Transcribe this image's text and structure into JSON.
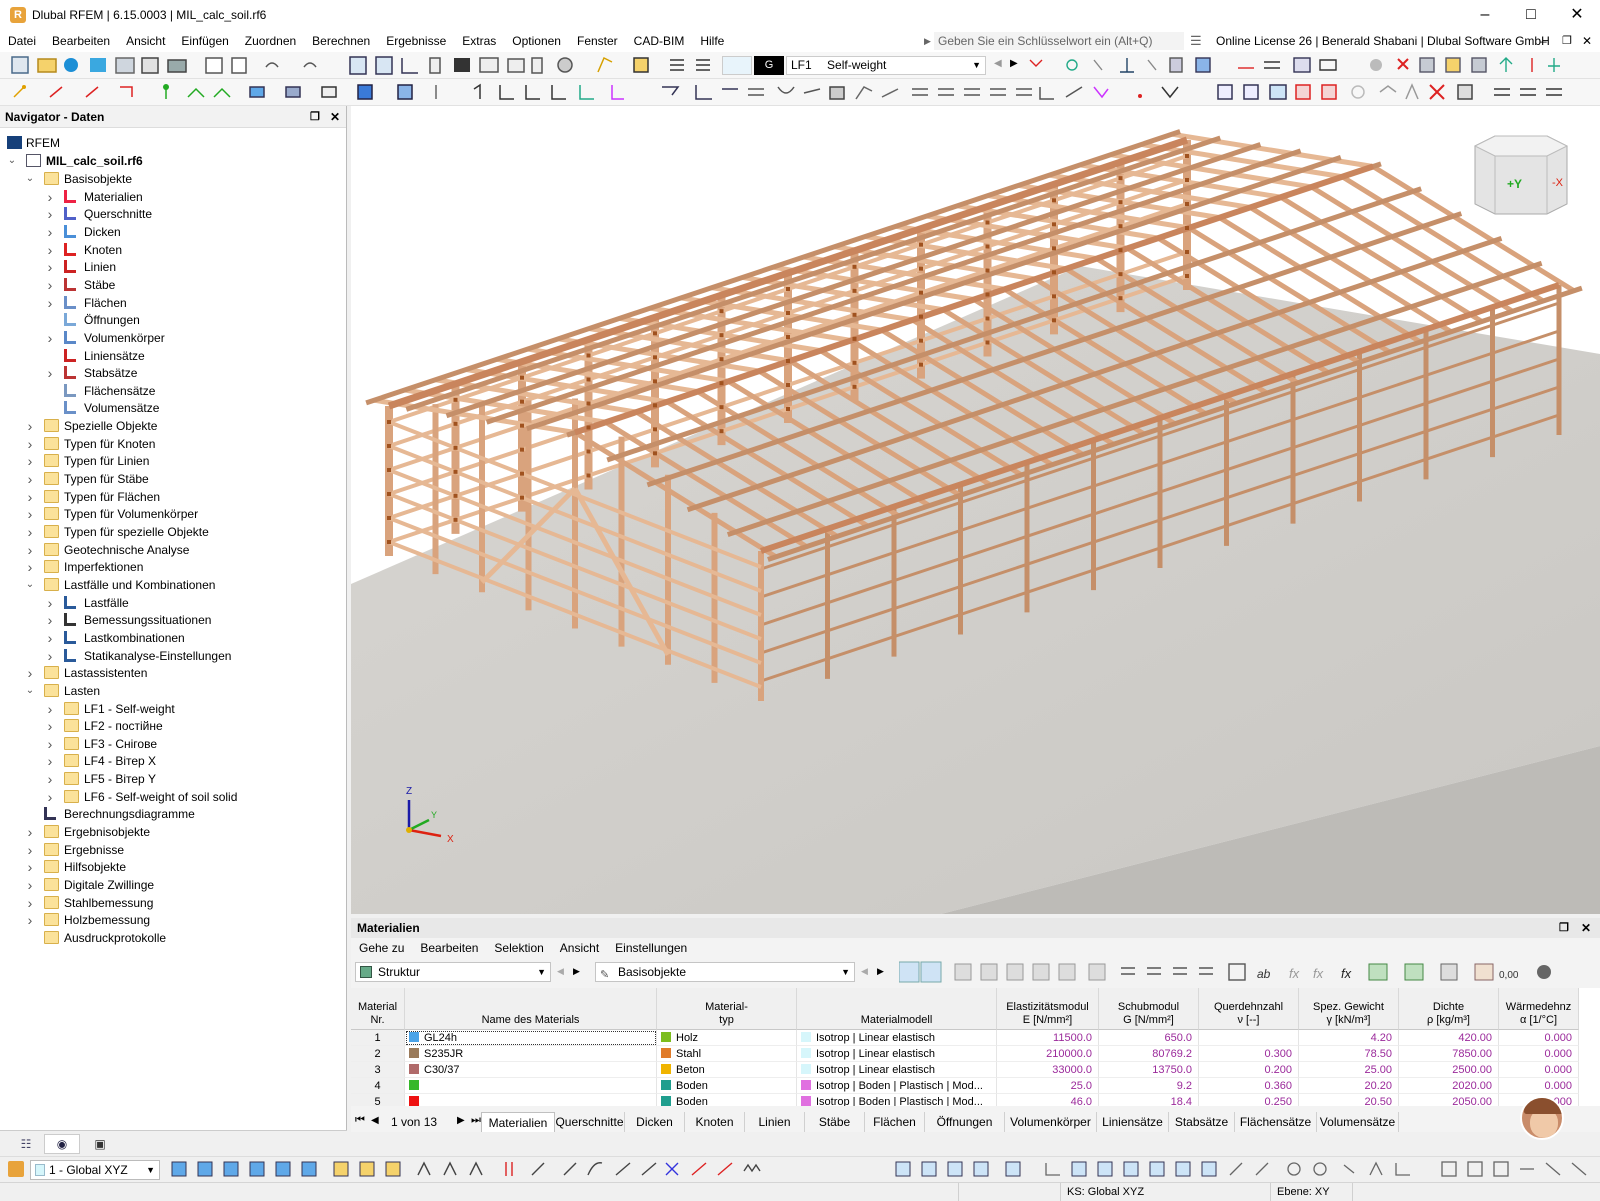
{
  "window": {
    "title": "Dlubal RFEM | 6.15.0003 | MIL_calc_soil.rf6"
  },
  "menu": {
    "items": [
      "Datei",
      "Bearbeiten",
      "Ansicht",
      "Einfügen",
      "Zuordnen",
      "Berechnen",
      "Ergebnisse",
      "Extras",
      "Optionen",
      "Fenster",
      "CAD-BIM",
      "Hilfe"
    ],
    "search_placeholder": "Geben Sie ein Schlüsselwort ein (Alt+Q)",
    "license": "Online License 26 | Benerald Shabani | Dlubal Software GmbH"
  },
  "toolbar": {
    "lc_badge": "G",
    "lc_id": "LF1",
    "lc_name": "Self-weight"
  },
  "navigator": {
    "title": "Navigator - Daten",
    "root": "RFEM",
    "file": "MIL_calc_soil.rf6",
    "items": [
      {
        "label": "Basisobjekte",
        "level": 1,
        "expand": "open",
        "icon": "folder"
      },
      {
        "label": "Materialien",
        "level": 2,
        "expand": "closed",
        "icon": "materials"
      },
      {
        "label": "Querschnitte",
        "level": 2,
        "expand": "closed",
        "icon": "sections"
      },
      {
        "label": "Dicken",
        "level": 2,
        "expand": "closed",
        "icon": "thickness"
      },
      {
        "label": "Knoten",
        "level": 2,
        "expand": "closed",
        "icon": "node"
      },
      {
        "label": "Linien",
        "level": 2,
        "expand": "closed",
        "icon": "line"
      },
      {
        "label": "Stäbe",
        "level": 2,
        "expand": "closed",
        "icon": "member"
      },
      {
        "label": "Flächen",
        "level": 2,
        "expand": "closed",
        "icon": "surface"
      },
      {
        "label": "Öffnungen",
        "level": 2,
        "expand": "none",
        "icon": "opening"
      },
      {
        "label": "Volumenkörper",
        "level": 2,
        "expand": "closed",
        "icon": "solid"
      },
      {
        "label": "Liniensätze",
        "level": 2,
        "expand": "none",
        "icon": "lineset"
      },
      {
        "label": "Stabsätze",
        "level": 2,
        "expand": "closed",
        "icon": "memberset"
      },
      {
        "label": "Flächensätze",
        "level": 2,
        "expand": "none",
        "icon": "surfaceset"
      },
      {
        "label": "Volumensätze",
        "level": 2,
        "expand": "none",
        "icon": "solidset"
      },
      {
        "label": "Spezielle Objekte",
        "level": 1,
        "expand": "closed",
        "icon": "folder"
      },
      {
        "label": "Typen für Knoten",
        "level": 1,
        "expand": "closed",
        "icon": "folder"
      },
      {
        "label": "Typen für Linien",
        "level": 1,
        "expand": "closed",
        "icon": "folder"
      },
      {
        "label": "Typen für Stäbe",
        "level": 1,
        "expand": "closed",
        "icon": "folder"
      },
      {
        "label": "Typen für Flächen",
        "level": 1,
        "expand": "closed",
        "icon": "folder"
      },
      {
        "label": "Typen für Volumenkörper",
        "level": 1,
        "expand": "closed",
        "icon": "folder"
      },
      {
        "label": "Typen für spezielle Objekte",
        "level": 1,
        "expand": "closed",
        "icon": "folder"
      },
      {
        "label": "Geotechnische Analyse",
        "level": 1,
        "expand": "closed",
        "icon": "folder"
      },
      {
        "label": "Imperfektionen",
        "level": 1,
        "expand": "closed",
        "icon": "folder"
      },
      {
        "label": "Lastfälle und Kombinationen",
        "level": 1,
        "expand": "open",
        "icon": "folder"
      },
      {
        "label": "Lastfälle",
        "level": 2,
        "expand": "closed",
        "icon": "loadcase"
      },
      {
        "label": "Bemessungssituationen",
        "level": 2,
        "expand": "closed",
        "icon": "designsit"
      },
      {
        "label": "Lastkombinationen",
        "level": 2,
        "expand": "closed",
        "icon": "loadcombo"
      },
      {
        "label": "Statikanalyse-Einstellungen",
        "level": 2,
        "expand": "closed",
        "icon": "analysis"
      },
      {
        "label": "Lastassistenten",
        "level": 1,
        "expand": "closed",
        "icon": "folder"
      },
      {
        "label": "Lasten",
        "level": 1,
        "expand": "open",
        "icon": "folder"
      },
      {
        "label": "LF1 - Self-weight",
        "level": 2,
        "expand": "closed",
        "icon": "folder"
      },
      {
        "label": "LF2 - постійне",
        "level": 2,
        "expand": "closed",
        "icon": "folder"
      },
      {
        "label": "LF3 - Снігове",
        "level": 2,
        "expand": "closed",
        "icon": "folder"
      },
      {
        "label": "LF4 - Вітер X",
        "level": 2,
        "expand": "closed",
        "icon": "folder"
      },
      {
        "label": "LF5 - Вітер Y",
        "level": 2,
        "expand": "closed",
        "icon": "folder"
      },
      {
        "label": "LF6 - Self-weight of soil solid",
        "level": 2,
        "expand": "closed",
        "icon": "folder"
      },
      {
        "label": "Berechnungsdiagramme",
        "level": 1,
        "expand": "none",
        "icon": "diagram"
      },
      {
        "label": "Ergebnisobjekte",
        "level": 1,
        "expand": "closed",
        "icon": "folder"
      },
      {
        "label": "Ergebnisse",
        "level": 1,
        "expand": "closed",
        "icon": "folder"
      },
      {
        "label": "Hilfsobjekte",
        "level": 1,
        "expand": "closed",
        "icon": "folder"
      },
      {
        "label": "Digitale Zwillinge",
        "level": 1,
        "expand": "closed",
        "icon": "folder"
      },
      {
        "label": "Stahlbemessung",
        "level": 1,
        "expand": "closed",
        "icon": "folder"
      },
      {
        "label": "Holzbemessung",
        "level": 1,
        "expand": "closed",
        "icon": "folder"
      },
      {
        "label": "Ausdruckprotokolle",
        "level": 1,
        "expand": "none",
        "icon": "folder"
      }
    ]
  },
  "viewport": {
    "axis_x": "X",
    "axis_y": "Y",
    "axis_z": "Z",
    "cube_y": "+Y",
    "cube_x": "-X"
  },
  "panel": {
    "title": "Materialien",
    "menu": [
      "Gehe zu",
      "Bearbeiten",
      "Selektion",
      "Ansicht",
      "Einstellungen"
    ],
    "combo_left": "Struktur",
    "combo_right": "Basisobjekte",
    "columns": [
      {
        "l1": "Material",
        "l2": "Nr."
      },
      {
        "l1": "",
        "l2": "Name des Materials"
      },
      {
        "l1": "Material-",
        "l2": "typ"
      },
      {
        "l1": "",
        "l2": "Materialmodell"
      },
      {
        "l1": "Elastizitätsmodul",
        "l2": "E [N/mm²]"
      },
      {
        "l1": "Schubmodul",
        "l2": "G [N/mm²]"
      },
      {
        "l1": "Querdehnzahl",
        "l2": "ν [--]"
      },
      {
        "l1": "Spez. Gewicht",
        "l2": "γ [kN/m³]"
      },
      {
        "l1": "Dichte",
        "l2": "ρ [kg/m³]"
      },
      {
        "l1": "Wärmedehnz",
        "l2": "α [1/°C]"
      }
    ],
    "rows": [
      {
        "nr": "1",
        "name": "GL24h",
        "name_color": "#4aa3e8",
        "type": "Holz",
        "type_color": "#7cbd1e",
        "model": "Isotrop | Linear elastisch",
        "model_color": "#d6f6fb",
        "e": "11500.0",
        "g": "650.0",
        "nu": "",
        "gamma": "4.20",
        "rho": "420.00",
        "alpha": "0.000"
      },
      {
        "nr": "2",
        "name": "S235JR",
        "name_color": "#9a7a5a",
        "type": "Stahl",
        "type_color": "#e07b2a",
        "model": "Isotrop | Linear elastisch",
        "model_color": "#d6f6fb",
        "e": "210000.0",
        "g": "80769.2",
        "nu": "0.300",
        "gamma": "78.50",
        "rho": "7850.00",
        "alpha": "0.000"
      },
      {
        "nr": "3",
        "name": "C30/37",
        "name_color": "#b06a6a",
        "type": "Beton",
        "type_color": "#f0b400",
        "model": "Isotrop | Linear elastisch",
        "model_color": "#d6f6fb",
        "e": "33000.0",
        "g": "13750.0",
        "nu": "0.200",
        "gamma": "25.00",
        "rho": "2500.00",
        "alpha": "0.000"
      },
      {
        "nr": "4",
        "name": "",
        "name_color": "#35b829",
        "type": "Boden",
        "type_color": "#1f9e8e",
        "model": "Isotrop | Boden | Plastisch | Mod...",
        "model_color": "#e070e0",
        "e": "25.0",
        "g": "9.2",
        "nu": "0.360",
        "gamma": "20.20",
        "rho": "2020.00",
        "alpha": "0.000"
      },
      {
        "nr": "5",
        "name": "",
        "name_color": "#ee1111",
        "type": "Boden",
        "type_color": "#1f9e8e",
        "model": "Isotrop | Boden | Plastisch | Mod...",
        "model_color": "#e070e0",
        "e": "46.0",
        "g": "18.4",
        "nu": "0.250",
        "gamma": "20.50",
        "rho": "2050.00",
        "alpha": "0.000"
      }
    ],
    "pager": "1 von 13",
    "tabs": [
      "Materialien",
      "Querschnitte",
      "Dicken",
      "Knoten",
      "Linien",
      "Stäbe",
      "Flächen",
      "Öffnungen",
      "Volumenkörper",
      "Liniensätze",
      "Stabsätze",
      "Flächensätze",
      "Volumensätze"
    ]
  },
  "bottom": {
    "view_combo": "1 - Global XYZ"
  },
  "status": {
    "cs": "KS: Global XYZ",
    "plane": "Ebene: XY"
  }
}
